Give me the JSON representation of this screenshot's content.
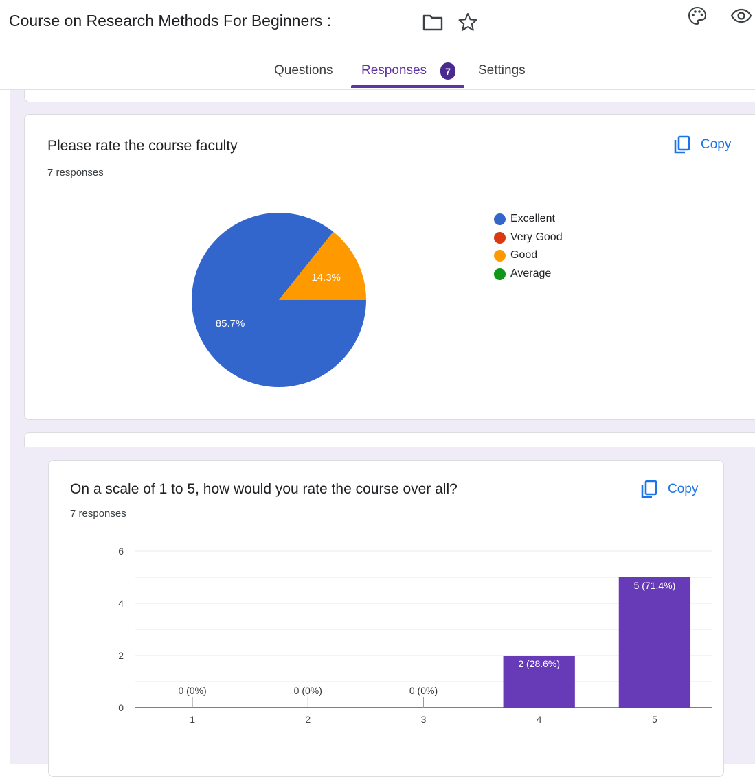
{
  "header": {
    "title": "Course on Research Methods For Beginners :",
    "folder_icon": "folder-icon",
    "star_icon": "star-icon",
    "palette_icon": "palette-icon",
    "preview_icon": "eye-icon"
  },
  "tabs": {
    "questions": "Questions",
    "responses": "Responses",
    "responses_count": "7",
    "settings": "Settings"
  },
  "colors": {
    "accent": "#5f34a5",
    "link": "#1a73e8",
    "excellent": "#3366cc",
    "very_good": "#dc3912",
    "good": "#ff9900",
    "average": "#109618",
    "bar": "#673ab7"
  },
  "question1": {
    "title": "Please rate the course faculty",
    "responses": "7 responses",
    "copy_label": "Copy"
  },
  "question2": {
    "title": "On a scale of 1 to 5, how would you rate the course over all?",
    "responses": "7 responses",
    "copy_label": "Copy"
  },
  "chart_data": [
    {
      "type": "pie",
      "categories": [
        "Excellent",
        "Very Good",
        "Good",
        "Average"
      ],
      "values": [
        85.7,
        0,
        14.3,
        0
      ],
      "slice_labels": [
        "85.7%",
        "",
        "14.3%",
        ""
      ],
      "colors": [
        "#3366cc",
        "#dc3912",
        "#ff9900",
        "#109618"
      ],
      "legend": "right"
    },
    {
      "type": "bar",
      "categories": [
        "1",
        "2",
        "3",
        "4",
        "5"
      ],
      "values": [
        0,
        0,
        0,
        2,
        5
      ],
      "data_labels": [
        "0 (0%)",
        "0 (0%)",
        "0 (0%)",
        "2 (28.6%)",
        "5 (71.4%)"
      ],
      "ylim": [
        0,
        6
      ],
      "y_ticks": [
        "0",
        "2",
        "4",
        "6"
      ],
      "grid": true,
      "color": "#673ab7"
    }
  ]
}
